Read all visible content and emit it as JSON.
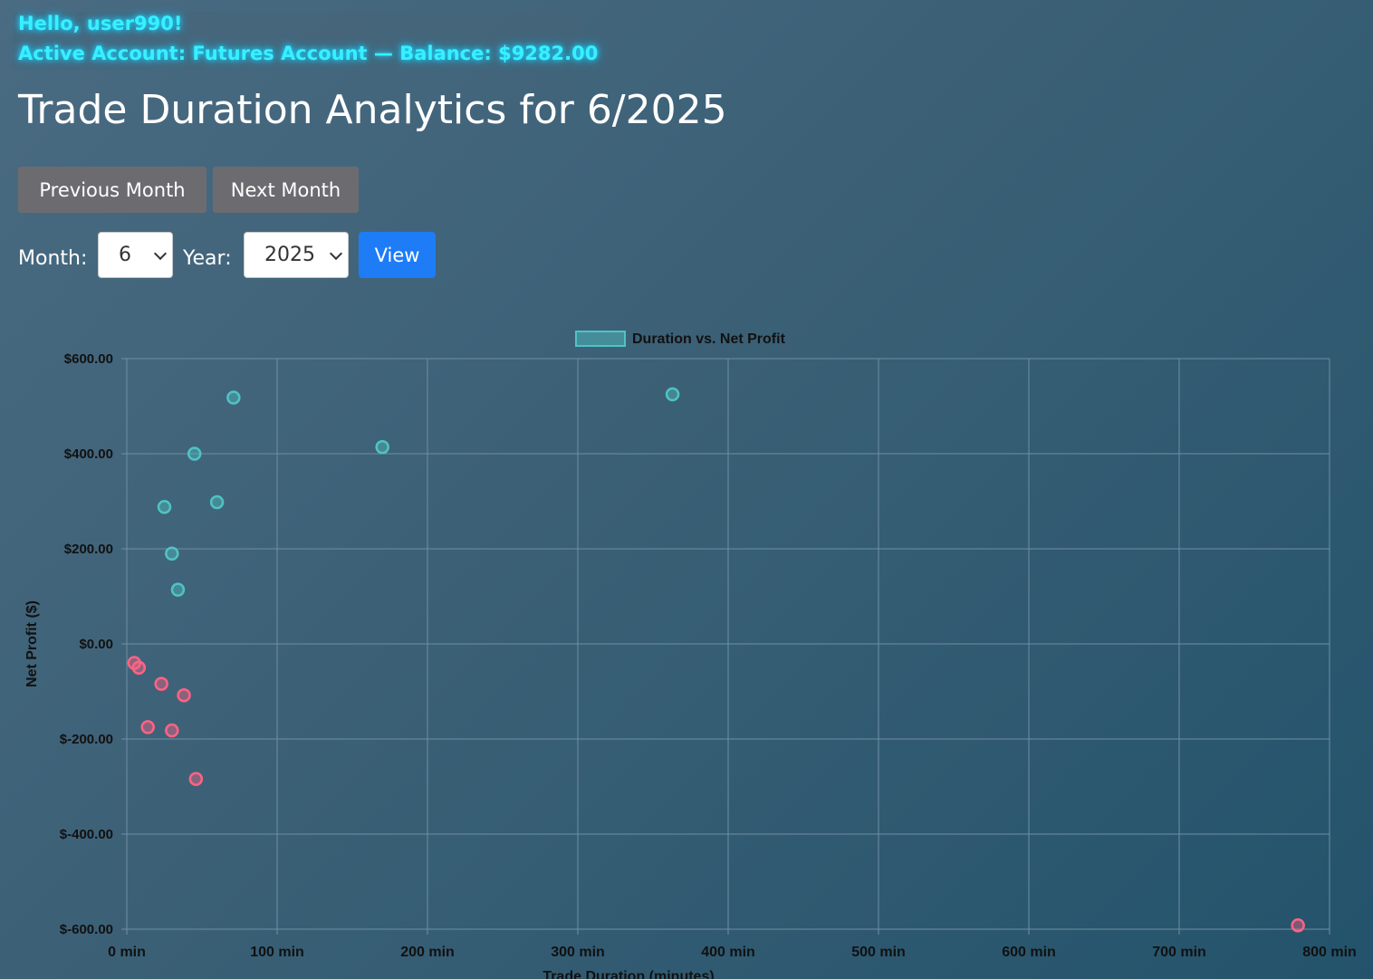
{
  "header": {
    "greeting": "Hello, user990!",
    "account_line": "Active Account: Futures Account — Balance: $9282.00"
  },
  "page_title": "Trade Duration Analytics for 6/2025",
  "nav": {
    "prev_label": "Previous Month",
    "next_label": "Next Month"
  },
  "filters": {
    "month_label": "Month:",
    "month_value": "6",
    "year_label": "Year:",
    "year_value": "2025",
    "view_label": "View"
  },
  "colors": {
    "positive": "#4fc3c3",
    "negative": "#ff6384",
    "grid": "#6f8fa4",
    "tick_text": "#111111"
  },
  "chart_data": {
    "type": "scatter",
    "legend_label": "Duration vs. Net Profit",
    "xlabel": "Trade Duration (minutes)",
    "ylabel": "Net Profit ($)",
    "xlim": [
      0,
      800
    ],
    "ylim": [
      -600,
      600
    ],
    "x_ticks": [
      "0 min",
      "100 min",
      "200 min",
      "300 min",
      "400 min",
      "500 min",
      "600 min",
      "700 min",
      "800 min"
    ],
    "y_ticks": [
      "$600.00",
      "$400.00",
      "$200.00",
      "$0.00",
      "$-200.00",
      "$-400.00",
      "$-600.00"
    ],
    "grid": true,
    "legend_position": "top",
    "points": [
      {
        "x": 71,
        "y": 518
      },
      {
        "x": 363,
        "y": 525
      },
      {
        "x": 45,
        "y": 400
      },
      {
        "x": 170,
        "y": 414
      },
      {
        "x": 25,
        "y": 288
      },
      {
        "x": 60,
        "y": 298
      },
      {
        "x": 30,
        "y": 190
      },
      {
        "x": 34,
        "y": 114
      },
      {
        "x": 5,
        "y": -40
      },
      {
        "x": 8,
        "y": -50
      },
      {
        "x": 23,
        "y": -84
      },
      {
        "x": 38,
        "y": -108
      },
      {
        "x": 14,
        "y": -175
      },
      {
        "x": 30,
        "y": -182
      },
      {
        "x": 46,
        "y": -284
      },
      {
        "x": 779,
        "y": -592
      }
    ]
  }
}
